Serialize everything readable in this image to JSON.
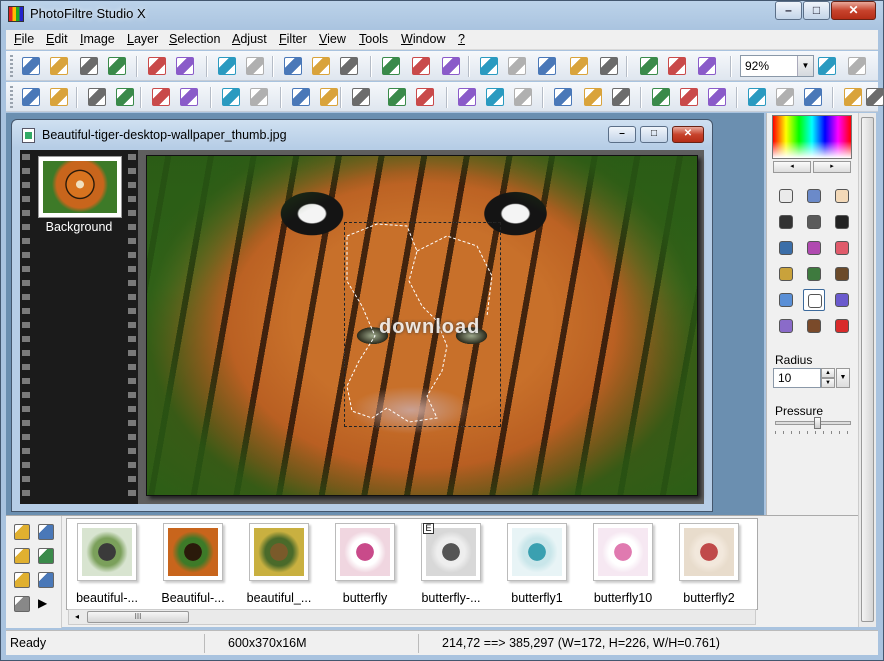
{
  "app": {
    "title": "PhotoFiltre Studio X"
  },
  "window_buttons": {
    "minimize": "–",
    "maximize": "□",
    "close": "✕"
  },
  "menubar": {
    "items": [
      {
        "key": "F",
        "rest": "ile"
      },
      {
        "key": "E",
        "rest": "dit"
      },
      {
        "key": "I",
        "rest": "mage"
      },
      {
        "key": "L",
        "rest": "ayer"
      },
      {
        "key": "S",
        "rest": "election"
      },
      {
        "key": "A",
        "rest": "djust"
      },
      {
        "key": "F",
        "rest": "ilter"
      },
      {
        "key": "V",
        "rest": "iew"
      },
      {
        "key": "T",
        "rest": "ools"
      },
      {
        "key": "W",
        "rest": "indow"
      },
      {
        "key": "?",
        "rest": ""
      }
    ]
  },
  "toolbar": {
    "zoom_value": "92%",
    "icons_row1": [
      "new-icon",
      "open-icon",
      "save-icon",
      "save-as-icon",
      "print-icon",
      "scanner-icon",
      "undo-icon",
      "redo-icon",
      "copy-icon",
      "paste-icon",
      "paste-as-icon",
      "color-mode-icon",
      "palette-icon",
      "automation-icon",
      "wizard-icon",
      "plugin-icon",
      "selection-icon",
      "text-icon",
      "transform-icon",
      "explorer-icon",
      "gear-icon",
      "browser-icon",
      "zoom-in-icon",
      "zoom-out-icon"
    ],
    "icons_row2": [
      "brightness-down-icon",
      "brightness-up-icon",
      "contrast-down-icon",
      "contrast-up-icon",
      "gamma-down-icon",
      "gamma-up-icon",
      "saturation-down-icon",
      "saturation-up-icon",
      "histogram-icon",
      "levels-icon",
      "invert-icon",
      "auto-levels-icon",
      "auto-contrast-icon",
      "mosaic-icon",
      "pixelate-icon",
      "texture-icon",
      "frame-icon",
      "blur-icon",
      "soften-icon",
      "sharpen-icon",
      "relief-icon",
      "sharpen-more-icon",
      "emboss-icon",
      "gradient-icon",
      "fade-icon",
      "stamp-icon",
      "brush-icon"
    ]
  },
  "document": {
    "title": "Beautiful-tiger-desktop-wallpaper_thumb.jpg",
    "layer_label": "Background",
    "watermark": "download"
  },
  "palette_arrows": {
    "left": "◂",
    "right": "▸"
  },
  "tools": [
    {
      "name": "pointer-tool-icon",
      "color": "#eaeaea"
    },
    {
      "name": "layer-manager-tool-icon",
      "color": "#6b8ac9"
    },
    {
      "name": "hand-tool-icon",
      "color": "#f3d9b8"
    },
    {
      "name": "eyedropper-tool-icon",
      "color": "#333"
    },
    {
      "name": "magic-wand-tool-icon",
      "color": "#5b5b5b"
    },
    {
      "name": "line-tool-icon",
      "color": "#222"
    },
    {
      "name": "fill-bucket-tool-icon",
      "color": "#3b6ea8"
    },
    {
      "name": "spray-tool-icon",
      "color": "#b04ab0"
    },
    {
      "name": "eraser-tool-icon",
      "color": "#e05b6b"
    },
    {
      "name": "brush-tool-icon",
      "color": "#c9a23b"
    },
    {
      "name": "advanced-brush-tool-icon",
      "color": "#3e7a3e"
    },
    {
      "name": "stamp-tool-icon",
      "color": "#6b4a2a"
    },
    {
      "name": "blur-tool-icon",
      "color": "#5a8fd6"
    },
    {
      "name": "smudge-tool-icon",
      "color": "#fff"
    },
    {
      "name": "paint-tube-tool-icon",
      "color": "#6a5acd"
    },
    {
      "name": "warp-tool-icon",
      "color": "#8a6bc9"
    },
    {
      "name": "clone-tool-icon",
      "color": "#7a4a2a"
    },
    {
      "name": "red-eye-tool-icon",
      "color": "#d92b2b"
    }
  ],
  "brush_options": {
    "radius_label": "Radius",
    "radius_value": "10",
    "pressure_label": "Pressure",
    "pressure_level": 0.55
  },
  "explorer": {
    "tools": [
      "explorer-tree-icon",
      "explorer-folder-icon",
      "explorer-back-icon",
      "explorer-open-icon",
      "explorer-refresh-icon",
      "explorer-options-icon",
      "explorer-grid-icon",
      "explorer-play-icon"
    ],
    "thumbnails": [
      {
        "label": "beautiful-...",
        "colors": [
          "#d8e4d0",
          "#3a3a3a",
          "#7ba05b"
        ]
      },
      {
        "label": "Beautiful-...",
        "colors": [
          "#c8651c",
          "#2a1a0a",
          "#3d7a28"
        ]
      },
      {
        "label": "beautiful_...",
        "colors": [
          "#c9b040",
          "#7a5a2a",
          "#4a6a2a"
        ]
      },
      {
        "label": "butterfly",
        "colors": [
          "#f0d6e0",
          "#c94a8a",
          "#fff"
        ]
      },
      {
        "label": "butterfly-...",
        "colors": [
          "#d8d8d8",
          "#555",
          "#eee"
        ],
        "badge": "E"
      },
      {
        "label": "butterfly1",
        "colors": [
          "#e8f4f6",
          "#3aa0b0",
          "#c9e6ea"
        ]
      },
      {
        "label": "butterfly10",
        "colors": [
          "#f6e8f2",
          "#e07ab0",
          "#fff"
        ]
      },
      {
        "label": "butterfly2",
        "colors": [
          "#e8dccc",
          "#c04a4a",
          "#f2e8dc"
        ]
      }
    ],
    "scroll_grip": "III",
    "scroll_left": "◂"
  },
  "status": {
    "state": "Ready",
    "image_info": "600x370x16M",
    "coords": "214,72 ==> 385,297 (W=172, H=226, W/H=0.761)"
  }
}
